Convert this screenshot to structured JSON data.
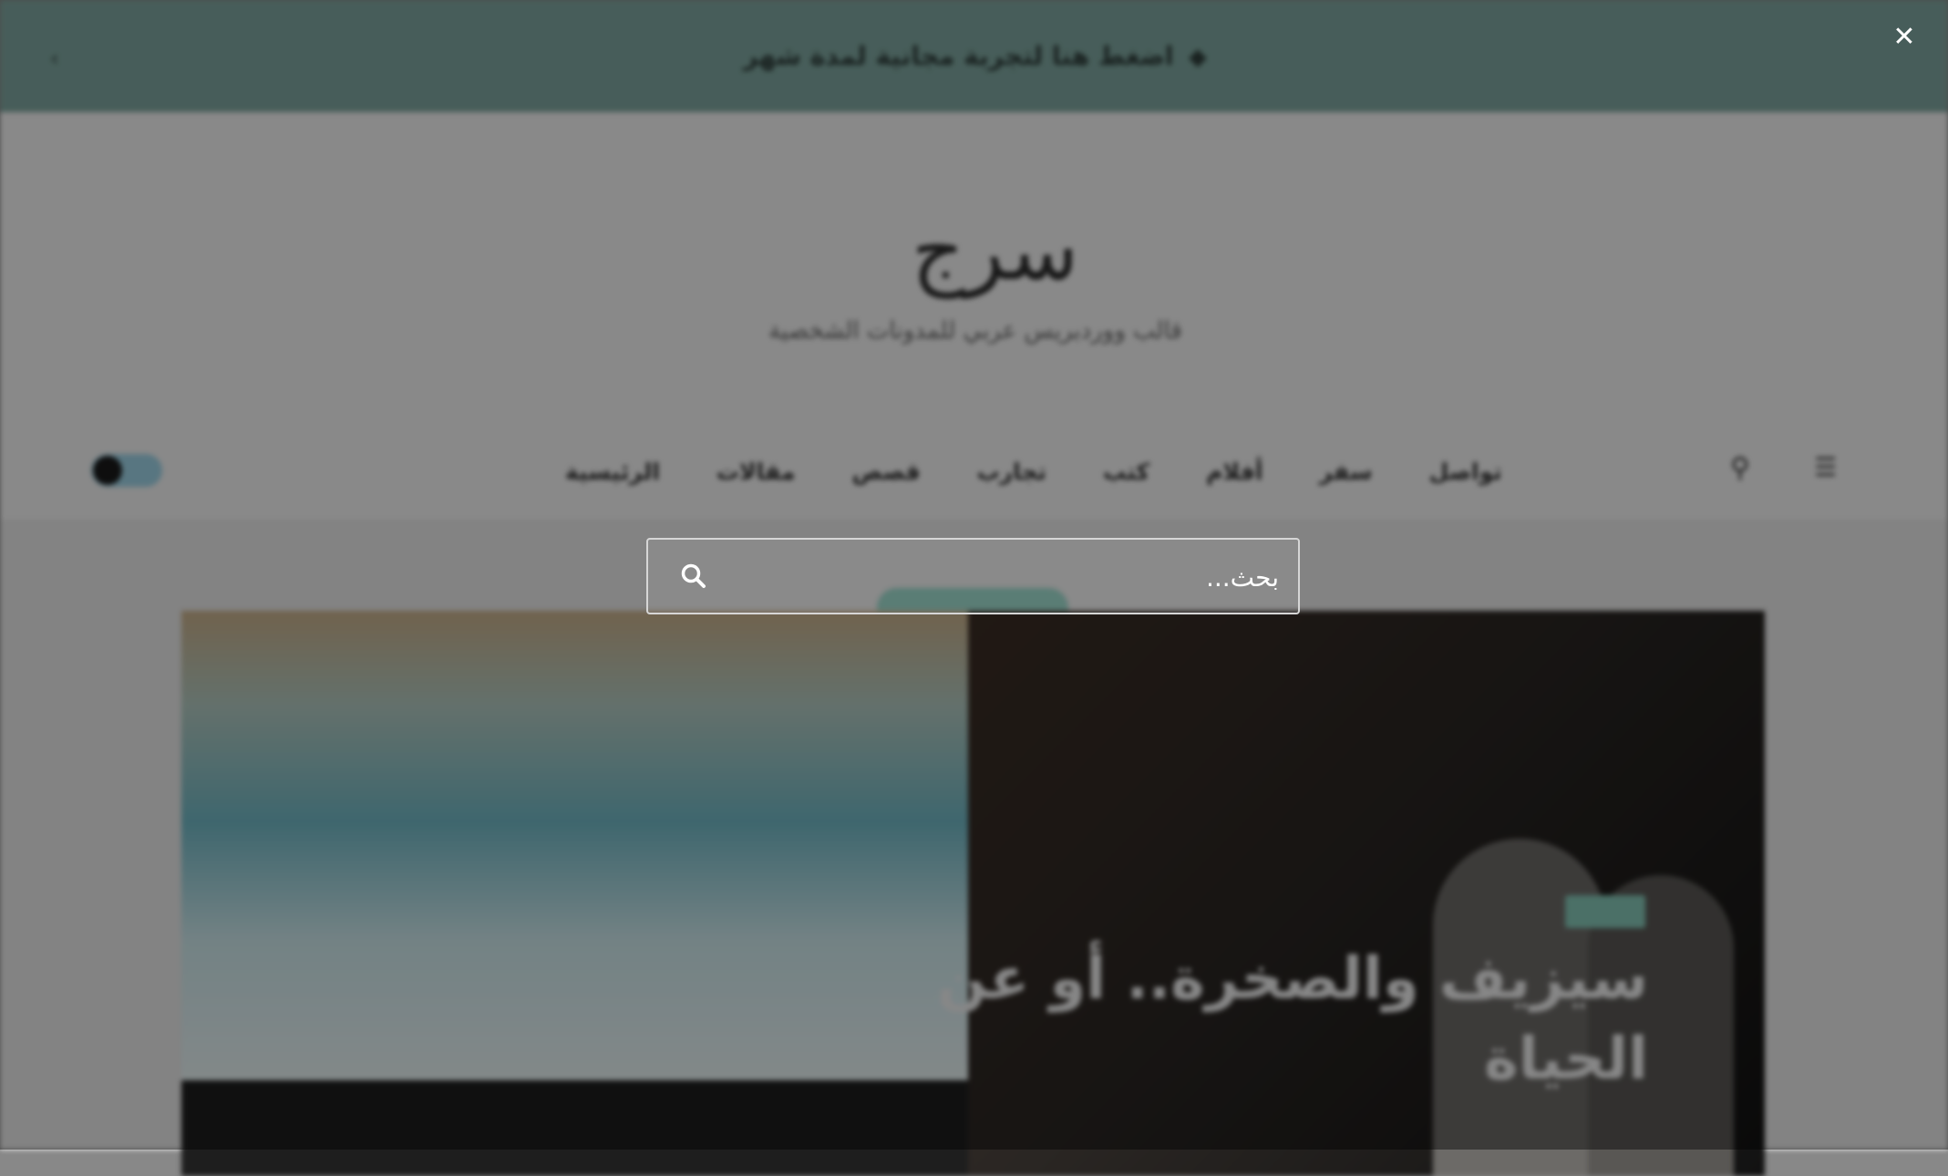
{
  "announcement": {
    "text": "اضغط هنا لتجربة مجانية لمدة شهر"
  },
  "site": {
    "logo_text": "سرج",
    "tagline": "قالب ووردبريس عربي للمدونات الشخصية"
  },
  "nav": {
    "items": [
      "الرئيسية",
      "مقالات",
      "قصص",
      "تجارب",
      "كتب",
      "أفلام",
      "سفر",
      "تواصل"
    ]
  },
  "hero": {
    "category_pill": "",
    "badge": "",
    "title": "سيزيف والصخرة.. أو عن الحياة"
  },
  "search": {
    "placeholder": "بحث...",
    "close_glyph": "✕"
  },
  "colors": {
    "overlay": "rgba(0,0,0,0.44)",
    "accent": "#7fa7a0",
    "search_border": "#d6d6d6"
  }
}
